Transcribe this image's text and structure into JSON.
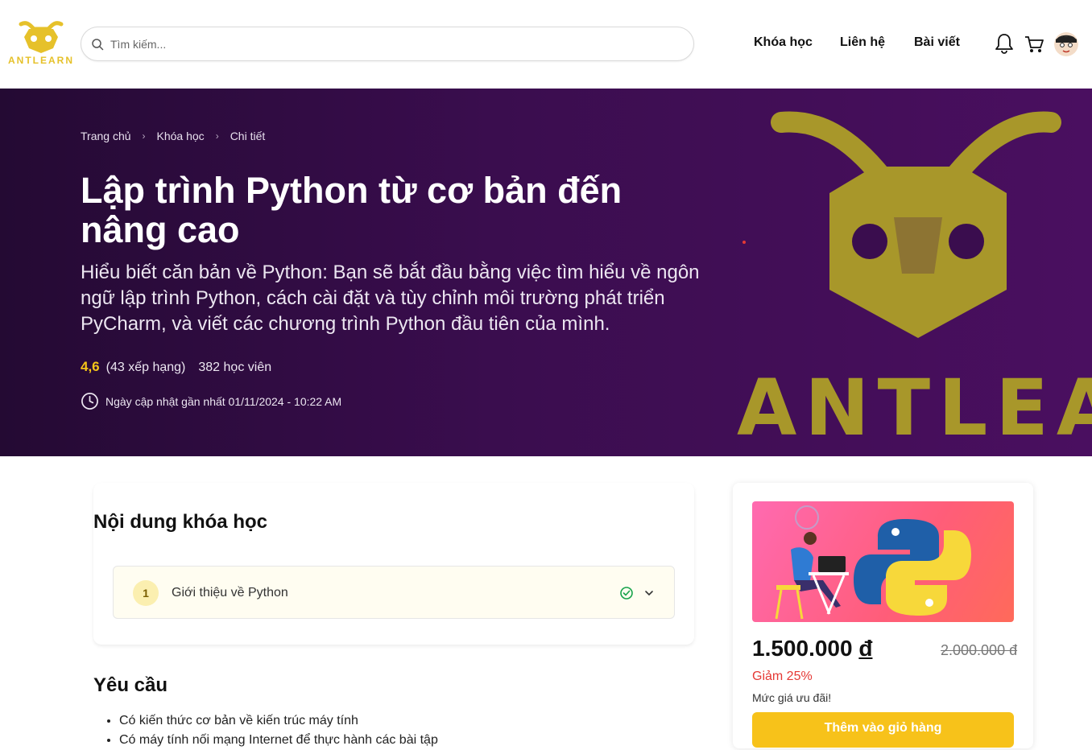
{
  "brand": {
    "logo_text": "ANTLEARN",
    "colors": {
      "gold": "#e6c12a",
      "hero_bg": "#3a0d4e",
      "accent_yellow": "#f7c21a",
      "discount_red": "#e53935"
    }
  },
  "search": {
    "placeholder": "Tìm kiếm..."
  },
  "nav": {
    "links": [
      "Khóa học",
      "Liên hệ",
      "Bài viết"
    ],
    "icons": [
      "bell-icon",
      "cart-icon",
      "avatar"
    ]
  },
  "breadcrumb": [
    "Trang chủ",
    "Khóa học",
    "Chi tiết"
  ],
  "course": {
    "title": "Lập trình Python từ cơ bản đến nâng cao",
    "description": "Hiểu biết căn bản về Python: Bạn sẽ bắt đầu bằng việc tìm hiểu về ngôn ngữ lập trình Python, cách cài đặt và tùy chỉnh môi trường phát triển PyCharm, và viết các chương trình Python đầu tiên của mình.",
    "rating": "4,6",
    "rating_count": "(43 xếp hạng)",
    "students": "382 học viên",
    "updated": "Ngày cập nhật gần nhất 01/11/2024 - 10:22 AM",
    "hero_brand": "ANTLEAR"
  },
  "content": {
    "title": "Nội dung khóa học",
    "modules": [
      {
        "number": "1",
        "title": "Giới thiệu về Python"
      }
    ]
  },
  "requirements": {
    "title": "Yêu cầu",
    "items": [
      "Có kiến thức cơ bản về kiến trúc máy tính",
      "Có máy tính nối mạng Internet để thực hành các bài tập"
    ]
  },
  "purchase": {
    "price_amount": "1.500.000",
    "price_currency": "đ",
    "old_price": "2.000.000 đ",
    "discount": "Giảm 25%",
    "offer": "Mức giá ưu đãi!",
    "add_to_cart": "Thêm vào giỏ hàng"
  }
}
